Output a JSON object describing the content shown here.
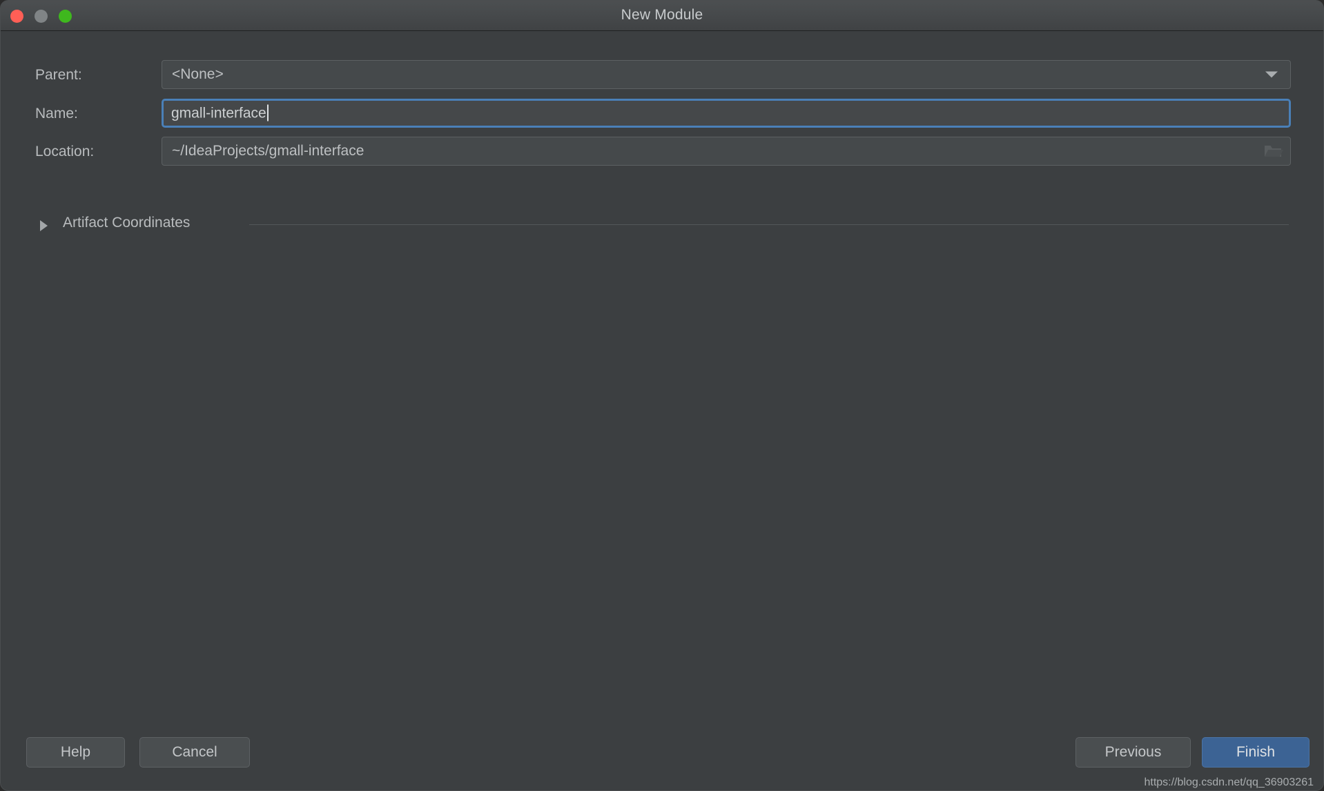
{
  "window": {
    "title": "New Module",
    "traffic_lights": [
      {
        "name": "close",
        "color": "#ff5f56"
      },
      {
        "name": "minimize",
        "color": "#808486"
      },
      {
        "name": "maximize",
        "color": "#3fb81e"
      }
    ],
    "background_color": "#3c3f41"
  },
  "form": {
    "parent": {
      "label": "Parent:",
      "value": "<None>",
      "icon": "chevron-down-icon"
    },
    "name": {
      "label": "Name:",
      "value": "gmall-interface",
      "focused": true,
      "focus_color": "#4a80b8"
    },
    "location": {
      "label": "Location:",
      "value": "~/IdeaProjects/gmall-interface",
      "icon": "folder-icon"
    }
  },
  "section": {
    "label": "Artifact Coordinates",
    "expanded": false,
    "icon": "triangle-right-icon"
  },
  "buttons": {
    "help": "Help",
    "cancel": "Cancel",
    "previous": "Previous",
    "finish": "Finish",
    "finish_color": "#3c6394"
  },
  "watermark": "https://blog.csdn.net/qq_36903261"
}
